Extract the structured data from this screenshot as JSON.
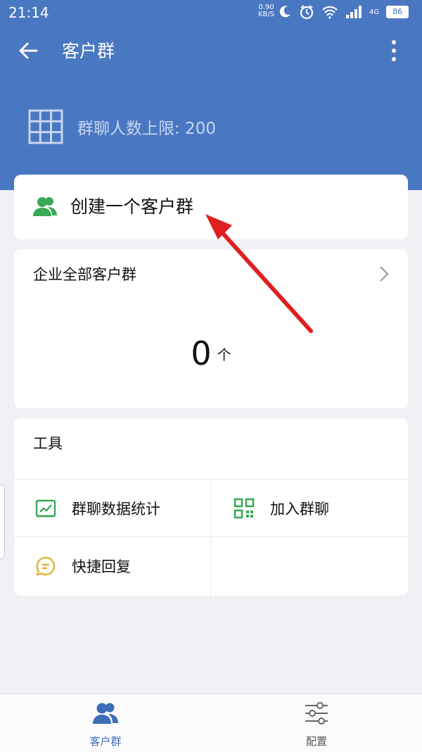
{
  "status_bar": {
    "time": "21:14",
    "net_speed_value": "0.90",
    "net_speed_unit": "KB/S",
    "network": "4G",
    "battery": "86"
  },
  "top_bar": {
    "title": "客户群"
  },
  "group_limit": {
    "text": "群聊人数上限: 200"
  },
  "create_card": {
    "label": "创建一个客户群"
  },
  "all_groups_card": {
    "heading": "企业全部客户群",
    "count": "0",
    "unit": "个"
  },
  "tools_card": {
    "heading": "工具",
    "items": [
      {
        "label": "群聊数据统计",
        "icon": "chart-icon"
      },
      {
        "label": "加入群聊",
        "icon": "qr-code-icon"
      },
      {
        "label": "快捷回复",
        "icon": "chat-bubble-icon"
      }
    ]
  },
  "tab_bar": {
    "tabs": [
      {
        "label": "客户群",
        "icon": "people-icon",
        "active": true
      },
      {
        "label": "配置",
        "icon": "sliders-icon",
        "active": false
      }
    ]
  },
  "colors": {
    "header_blue": "#4a77c2",
    "accent_green": "#3aa857",
    "accent_yellow": "#e3b33b",
    "arrow_red": "#e02020",
    "active_tab": "#3d6db9"
  }
}
